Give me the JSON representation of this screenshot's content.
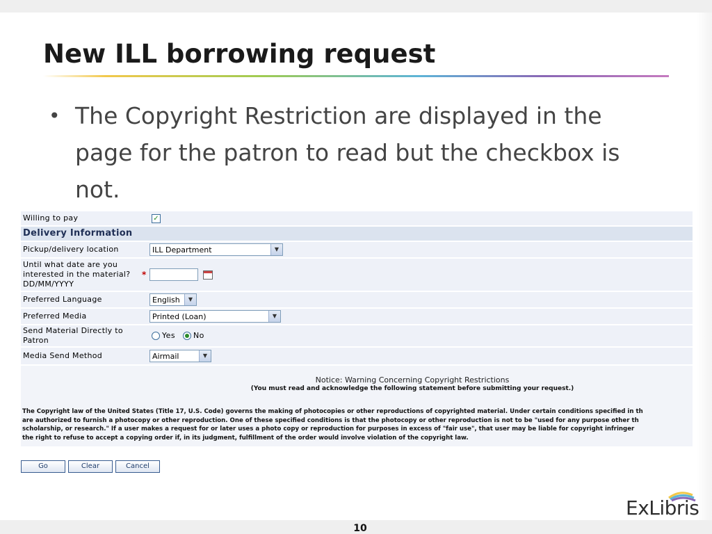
{
  "slide": {
    "title": "New ILL borrowing request",
    "bullet": "The Copyright Restriction are displayed in the page for the patron to read but the checkbox is not.",
    "page_number": "10",
    "logo_text": "ExLibris"
  },
  "form": {
    "willing_to_pay_label": "Willing to pay",
    "willing_to_pay_checked": true,
    "section_title": "Delivery Information",
    "pickup_label": "Pickup/delivery location",
    "pickup_value": "ILL Department",
    "until_date_label": "Until what date are you interested in the material? DD/MM/YYYY",
    "required_mark": "*",
    "until_date_value": "",
    "language_label": "Preferred Language",
    "language_value": "English",
    "media_label": "Preferred Media",
    "media_value": "Printed (Loan)",
    "send_direct_label": "Send Material Directly to Patron",
    "send_direct_options": {
      "yes": "Yes",
      "no": "No"
    },
    "send_direct_selected": "No",
    "send_method_label": "Media Send Method",
    "send_method_value": "Airmail"
  },
  "notice": {
    "title": "Notice: Warning Concerning Copyright Restrictions",
    "subtitle": "(You must read and acknowledge the following statement before submitting your request.)",
    "lines": [
      "The Copyright law of the United States (Title 17, U.S. Code) governs the making of photocopies or other reproductions of copyrighted material. Under certain conditions specified in th",
      "are authorized to furnish a photocopy or other reproduction. One of these specified conditions is that the photocopy or other reproduction is not to be \"used for any purpose other th",
      "scholarship, or research.\" If a user makes a request for or later uses a photo copy or reproduction for purposes in excess of \"fair use\", that user may be liable for copyright infringer",
      "the right to refuse to accept a copying order if, in its judgment, fulfillment of the order would involve violation of the copyright law."
    ]
  },
  "buttons": {
    "go": "Go",
    "clear": "Clear",
    "cancel": "Cancel"
  },
  "colors": {
    "title": "#1a1a1a",
    "bullet": "#444444",
    "row_bg": "#eef1f8",
    "section_bg": "#dbe3ef",
    "required": "#c00000"
  },
  "icons": {
    "calendar": "calendar-icon",
    "dropdown": "chevron-down-icon",
    "bullet": "bullet-dot"
  }
}
